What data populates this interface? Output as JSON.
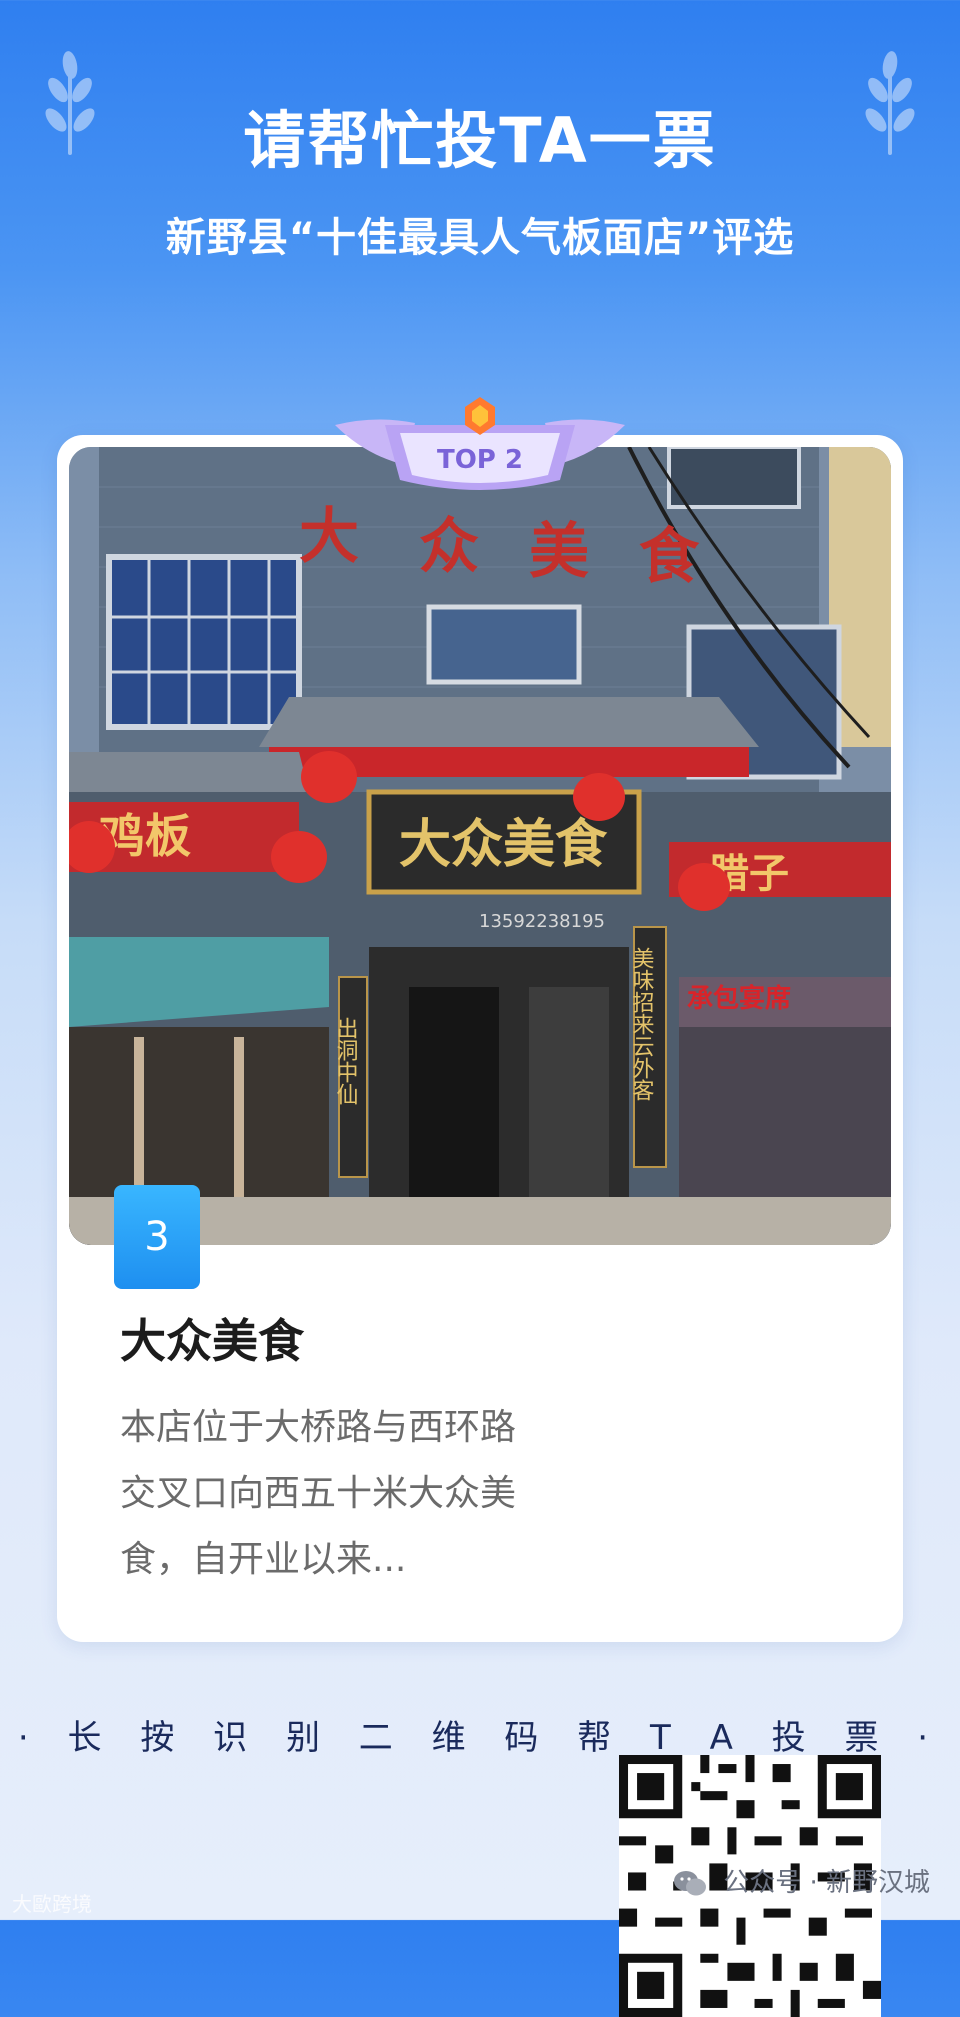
{
  "header": {
    "title": "请帮忙投TA一票",
    "subtitle": "新野县“十佳最具人气板面店”评选"
  },
  "badge": {
    "label": "TOP 2"
  },
  "storefront": {
    "main_sign": "大众美食",
    "plaque": "大众美食",
    "phone": "13592238195",
    "left_banner": "鸡板",
    "right_banner": "腊子",
    "window_sign": "承包宴席",
    "pillar_left": "出洞中仙",
    "pillar_right": "美味招来云外客"
  },
  "card": {
    "rank": "3",
    "shop_name": "大众美食",
    "description": "本店位于大桥路与西环路交叉口向西五十米大众美食，自开业以来..."
  },
  "instruction": "· 长 按 识 别 二 维 码 帮 T A 投 票 ·",
  "footer": {
    "source": "公众号 · 新野汉城",
    "watermark": "大歐跨境"
  },
  "colors": {
    "accent": "#2f7ff0",
    "rank_badge": "#1e8ff0",
    "badge_purple": "#9b7cf0"
  }
}
